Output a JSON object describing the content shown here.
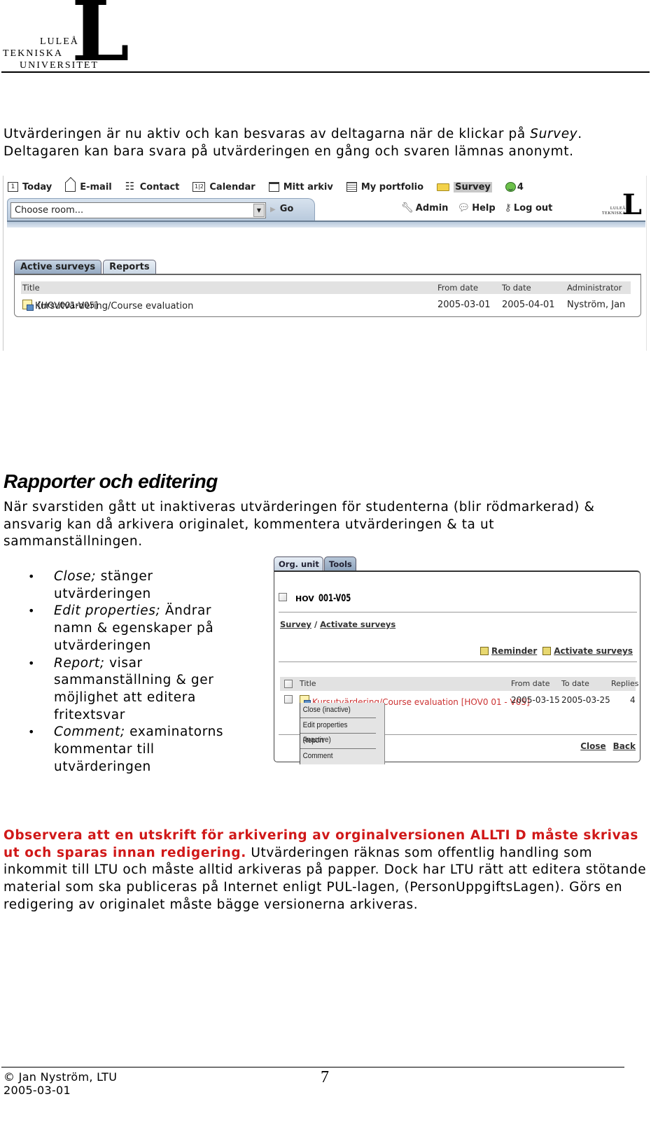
{
  "logo": {
    "mark": "L",
    "line1": "LULEÅ",
    "line2": "TEKNISKA",
    "line3": "UNIVERSITET"
  },
  "intro": {
    "line1_pre": "Utvärderingen är nu aktiv och kan besvaras av deltagarna när de klickar på ",
    "line1_em": "Survey",
    "line1_post": ".",
    "line2": "Deltagaren kan bara svara på utvärderingen en gång och svaren lämnas anonymt."
  },
  "screenshot1": {
    "nav": [
      {
        "label": "Today",
        "icon": "calendar-day-icon"
      },
      {
        "label": "E-mail",
        "icon": "mail-icon"
      },
      {
        "label": "Contact",
        "icon": "contact-icon"
      },
      {
        "label": "Calendar",
        "icon": "calendar-icon"
      },
      {
        "label": "Mitt arkiv",
        "icon": "archive-icon"
      },
      {
        "label": "My portfolio",
        "icon": "portfolio-icon"
      },
      {
        "label": "Survey",
        "icon": "folder-icon",
        "active": true
      },
      {
        "label": "4",
        "icon": "smiley-icon"
      }
    ],
    "today_icon_text": "1",
    "calendar_icon_text": "1|2",
    "room_select": "Choose room...",
    "go": "Go",
    "util": {
      "admin": "Admin",
      "help": "Help",
      "logout": "Log out"
    },
    "mini_logo": {
      "mark": "L",
      "text1": "LULEÅ",
      "text2": "TEKNISKA"
    },
    "tabs": [
      "Active surveys",
      "Reports"
    ],
    "table": {
      "headers": [
        "Title",
        "From date",
        "To date",
        "Administrator"
      ],
      "rows": [
        {
          "title": "Kursutvärdering/Course evaluation",
          "code": "[HOV001-V05]",
          "from": "2005-03-01",
          "to": "2005-04-01",
          "admin": "Nyström, Jan"
        }
      ]
    }
  },
  "section2": {
    "title": "Rapporter och editering",
    "para_line1": "När svarstiden gått ut inaktiveras utvärderingen för studenterna (blir rödmarkerad) &",
    "para_line2": "ansvarig kan då arkivera originalet, kommentera utvärderingen & ta ut",
    "para_line3": "sammanställningen.",
    "bullets": [
      {
        "em": "Close;",
        "text": " stänger utvärderingen"
      },
      {
        "em": "Edit properties;",
        "text": " Ändrar namn & egenskaper på utvärderingen"
      },
      {
        "em": "Report;",
        "text": " visar sammanställning & ger möjlighet att editera fritextsvar"
      },
      {
        "em": "Comment;",
        "text": " examinatorns kommentar till utvärderingen"
      }
    ]
  },
  "screenshot2": {
    "tabs": [
      "Org. unit",
      "Tools"
    ],
    "unit_prefix": "HOV",
    "unit_code": "001-V05",
    "breadcrumb": {
      "part1": "Survey",
      "sep": " / ",
      "part2": "Activate surveys"
    },
    "actions": [
      "Reminder",
      "Activate surveys"
    ],
    "table": {
      "headers": [
        "Title",
        "From date",
        "To date",
        "Replies"
      ],
      "rows": [
        {
          "title": "Kursutvärdering/Course evaluation [HOV0 01 - V05]",
          "from": "2005-03-15",
          "to": "2005-03-25",
          "replies": "4"
        }
      ]
    },
    "context_menu": [
      "Close (inactive)",
      "Edit properties (inactive)",
      "Report",
      "Comment"
    ],
    "footer_links": [
      "Close",
      "Back"
    ]
  },
  "notice": {
    "red": "Observera att en utskrift för arkivering av orginalversionen ALLTI D måste skrivas ut och sparas innan redigering.",
    "rest": " Utvärderingen räknas som offentlig handling som inkommit till LTU och måste alltid arkiveras på papper. Dock har LTU rätt att editera stötande material som ska publiceras på Internet enligt PUL-lagen, (PersonUppgiftsLagen). Görs en redigering av originalet måste bägge versionerna arkiveras."
  },
  "footer": {
    "author": "© Jan Nyström, LTU",
    "date": "2005-03-01",
    "page": "7"
  },
  "colors": {
    "warning_red": "#d01818",
    "inactive_row_red": "#cc3333",
    "tab_blue": "#94a9c2"
  }
}
